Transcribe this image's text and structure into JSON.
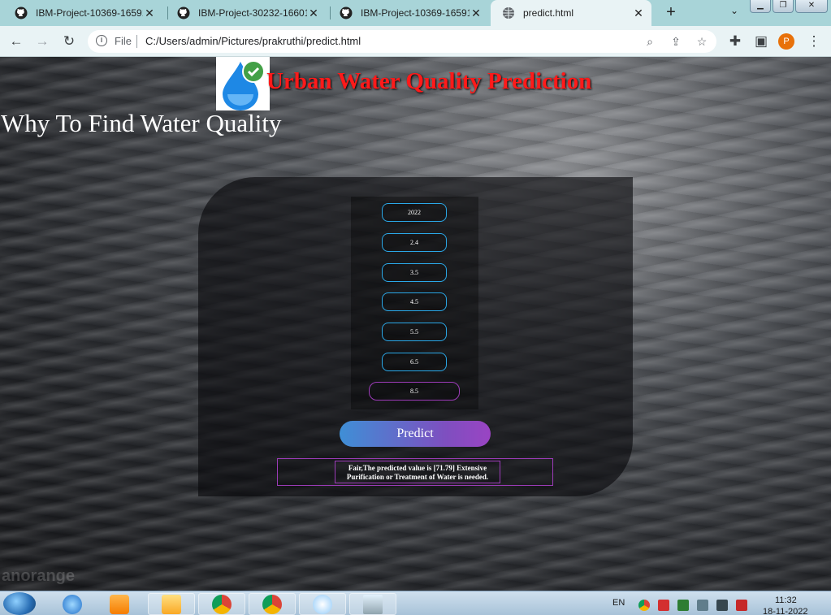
{
  "browser": {
    "tabs": [
      {
        "title": "IBM-Project-10369-16591",
        "active": false
      },
      {
        "title": "IBM-Project-30232-16601",
        "active": false
      },
      {
        "title": "IBM-Project-10369-16591",
        "active": false
      },
      {
        "title": "predict.html",
        "active": true
      }
    ],
    "new_tab_label": "+",
    "tab_menu_label": "⌄",
    "address": {
      "scheme_label": "File",
      "url": "C:/Users/admin/Pictures/prakruthi/predict.html"
    },
    "profile_initial": "P"
  },
  "page": {
    "site_title": "Urban Water Quality Prediction",
    "heading": "Why To Find Water Quality",
    "form": {
      "fields": [
        "2022",
        "2.4",
        "3.5",
        "4.5",
        "5.5",
        "6.5",
        "8.5"
      ]
    },
    "predict_button": "Predict",
    "result_text": "Fair,The predicted value is [71.79] Extensive Purification or Treatment of Water is needed.",
    "watermark": "anorange"
  },
  "taskbar": {
    "language": "EN",
    "time": "11:32",
    "date": "18-11-2022"
  },
  "colors": {
    "title_red": "#ff1a1a",
    "field_border": "#2aa8e8",
    "accent_purple": "#9c3bb8",
    "profile_orange": "#e8710a"
  }
}
